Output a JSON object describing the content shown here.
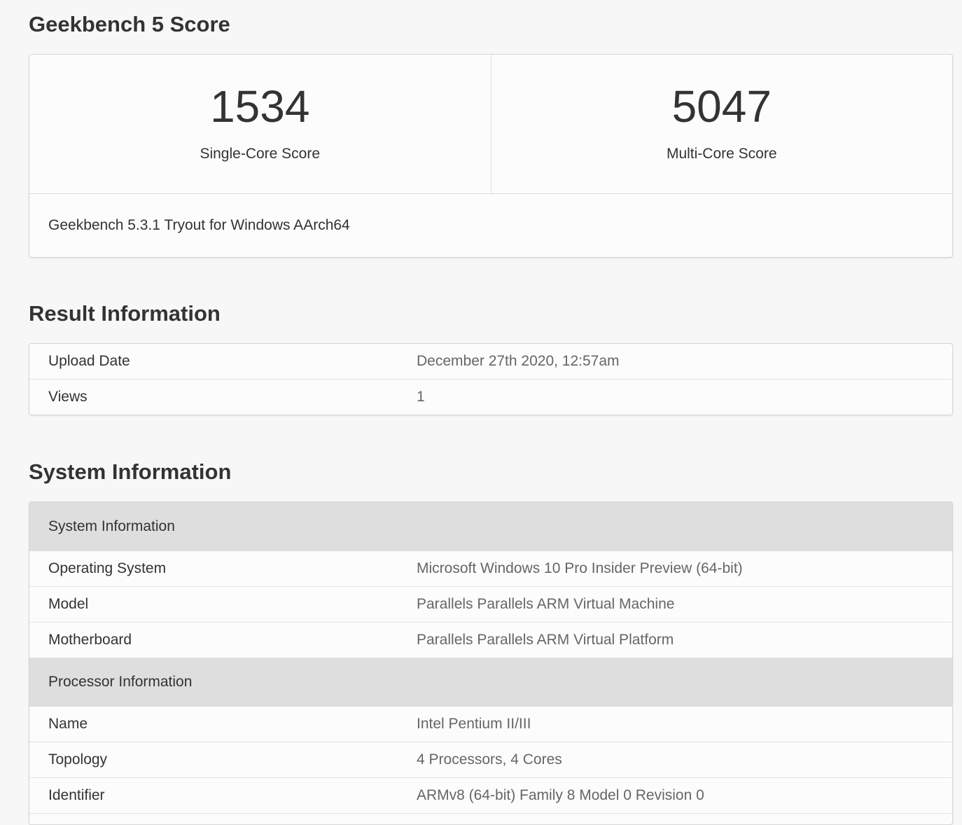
{
  "score_section": {
    "title": "Geekbench 5 Score",
    "single": {
      "value": "1534",
      "label": "Single-Core Score"
    },
    "multi": {
      "value": "5047",
      "label": "Multi-Core Score"
    },
    "version": "Geekbench 5.3.1 Tryout for Windows AArch64"
  },
  "result_section": {
    "title": "Result Information",
    "rows": [
      {
        "key": "Upload Date",
        "value": "December 27th 2020, 12:57am"
      },
      {
        "key": "Views",
        "value": "1"
      }
    ]
  },
  "system_section": {
    "title": "System Information",
    "groups": [
      {
        "heading": "System Information",
        "rows": [
          {
            "key": "Operating System",
            "value": "Microsoft Windows 10 Pro Insider Preview (64-bit)"
          },
          {
            "key": "Model",
            "value": "Parallels Parallels ARM Virtual Machine"
          },
          {
            "key": "Motherboard",
            "value": "Parallels Parallels ARM Virtual Platform"
          }
        ]
      },
      {
        "heading": "Processor Information",
        "rows": [
          {
            "key": "Name",
            "value": "Intel Pentium II/III"
          },
          {
            "key": "Topology",
            "value": "4 Processors, 4 Cores"
          },
          {
            "key": "Identifier",
            "value": "ARMv8 (64-bit) Family 8 Model 0 Revision 0"
          }
        ]
      }
    ]
  }
}
